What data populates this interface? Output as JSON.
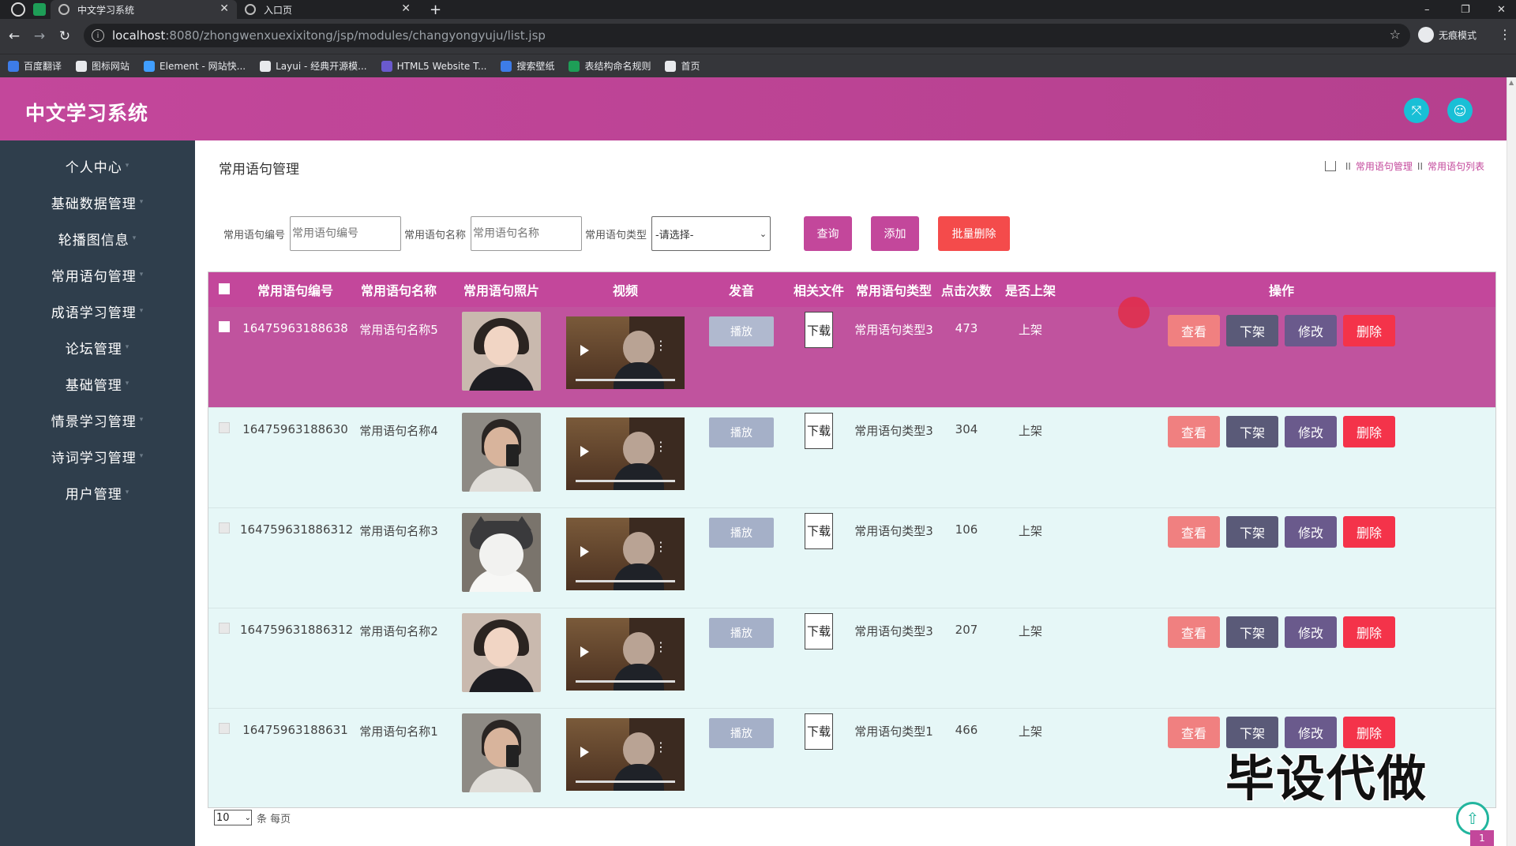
{
  "browser": {
    "tabs": [
      {
        "title": "中文学习系统",
        "close": "✕"
      },
      {
        "title": "入口页",
        "close": "✕"
      }
    ],
    "new_tab": "+",
    "window_controls": [
      "–",
      "❐",
      "✕"
    ],
    "nav": {
      "back": "←",
      "forward": "→",
      "reload": "↻"
    },
    "url_host": "localhost",
    "url_path": ":8080/zhongwenxuexixitong/jsp/modules/changyongyuju/list.jsp",
    "incognito_label": "无痕模式",
    "bookmarks": [
      {
        "label": "百度翻译",
        "color": "#3d7ce8"
      },
      {
        "label": "图标网站",
        "color": "#e8eaed"
      },
      {
        "label": "Element - 网站快...",
        "color": "#409eff"
      },
      {
        "label": "Layui - 经典开源模...",
        "color": "#e8eaed"
      },
      {
        "label": "HTML5 Website T...",
        "color": "#6a5acd"
      },
      {
        "label": "搜索壁纸",
        "color": "#3d7ce8"
      },
      {
        "label": "表结构命名规则",
        "color": "#1e9e57"
      },
      {
        "label": "首页",
        "color": "#e8eaed"
      }
    ]
  },
  "app": {
    "title": "中文学习系统",
    "accent_color": "#c3479b",
    "header_buttons": [
      "fullscreen-icon",
      "user-icon"
    ]
  },
  "sidebar": {
    "items": [
      {
        "label": "个人中心"
      },
      {
        "label": "基础数据管理"
      },
      {
        "label": "轮播图信息"
      },
      {
        "label": "常用语句管理"
      },
      {
        "label": "成语学习管理"
      },
      {
        "label": "论坛管理"
      },
      {
        "label": "基础管理"
      },
      {
        "label": "情景学习管理"
      },
      {
        "label": "诗词学习管理"
      },
      {
        "label": "用户管理"
      }
    ]
  },
  "page": {
    "title": "常用语句管理",
    "breadcrumb": [
      "常用语句管理",
      "常用语句列表"
    ],
    "breadcrumb_sep": "II"
  },
  "search": {
    "code_label": "常用语句编号",
    "code_placeholder": "常用语句编号",
    "name_label": "常用语句名称",
    "name_placeholder": "常用语句名称",
    "type_label": "常用语句类型",
    "type_selected": "-请选择-",
    "query_btn": "查询",
    "add_btn": "添加",
    "batch_delete_btn": "批量删除"
  },
  "table": {
    "headers": [
      "常用语句编号",
      "常用语句名称",
      "常用语句照片",
      "视频",
      "发音",
      "相关文件",
      "常用语句类型",
      "点击次数",
      "是否上架",
      "操作"
    ],
    "play_label": "播放",
    "download_label": "下载",
    "actions": {
      "view": "查看",
      "off_shelf": "下架",
      "edit": "修改",
      "delete": "删除"
    },
    "rows": [
      {
        "code": "16475963188638",
        "name": "常用语句名称5",
        "photo": "girl",
        "type": "常用语句类型3",
        "clicks": "473",
        "shelf": "上架"
      },
      {
        "code": "16475963188630",
        "name": "常用语句名称4",
        "photo": "man",
        "type": "常用语句类型3",
        "clicks": "304",
        "shelf": "上架"
      },
      {
        "code": "164759631886312",
        "name": "常用语句名称3",
        "photo": "cat",
        "type": "常用语句类型3",
        "clicks": "106",
        "shelf": "上架"
      },
      {
        "code": "164759631886312",
        "name": "常用语句名称2",
        "photo": "girl",
        "type": "常用语句类型3",
        "clicks": "207",
        "shelf": "上架"
      },
      {
        "code": "16475963188631",
        "name": "常用语句名称1",
        "photo": "man",
        "type": "常用语句类型1",
        "clicks": "466",
        "shelf": "上架"
      }
    ]
  },
  "pager": {
    "page_size": "10",
    "per_page_label": "条 每页",
    "current_page": "1"
  },
  "overlay": {
    "watermark": "毕设代做",
    "back_to_top": "⇧"
  }
}
